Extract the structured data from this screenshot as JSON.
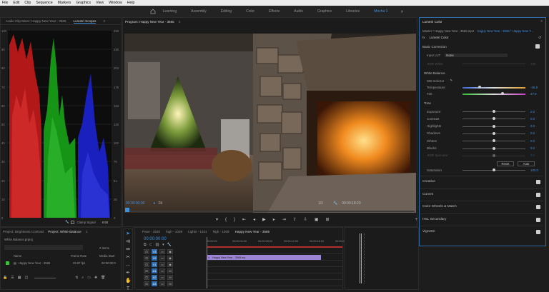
{
  "menubar": [
    "File",
    "Edit",
    "Clip",
    "Sequence",
    "Markers",
    "Graphics",
    "View",
    "Window",
    "Help"
  ],
  "workspaces": {
    "tabs": [
      "Learning",
      "Assembly",
      "Editing",
      "Color",
      "Effects",
      "Audio",
      "Graphics",
      "Libraries",
      "Mocha 1"
    ],
    "active": "Mocha 1",
    "more": "»"
  },
  "scopes_panel": {
    "tab_mixer": "Audio Clip Mixer: Happy New Year - 3565",
    "tab_scopes": "Lumetri Scopes",
    "menu": "≡",
    "left_scale": [
      "100",
      "90",
      "80",
      "70",
      "60",
      "50",
      "40",
      "30",
      "20",
      "10",
      "0"
    ],
    "right_scale": [
      "255",
      "230",
      "204",
      "178",
      "153",
      "128",
      "102",
      "76",
      "51",
      "26",
      "0"
    ],
    "clamp_label": "Clamp Signal",
    "bit_label": "8 Bit"
  },
  "program": {
    "title": "Program: Happy New Year - 3565",
    "menu": "≡",
    "timecode_left": "00:00:00:00",
    "fit_option": "Fit",
    "quality": "1/2",
    "timecode_right": "00:00:18:20"
  },
  "lumetri": {
    "title": "Lumetri Color",
    "menu": "≡",
    "master": "Master * Happy New Year - 3565.mp4",
    "clip": "Happy New Year - 3565 * Happy New Y...",
    "effect": "Lumetri Color",
    "basic_correction": "Basic Correction",
    "input_lut_label": "Input LUT",
    "input_lut_value": "None",
    "hdr_white_label": "HDR White",
    "hdr_white_value": "100",
    "white_balance": "White Balance",
    "wb_selector": "WB Selector",
    "temperature_label": "Temperature",
    "temperature_value": "-46.8",
    "temperature_pct": 0.27,
    "tint_label": "Tint",
    "tint_value": "27.8",
    "tint_pct": 0.64,
    "tone": "Tone",
    "tone_rows": [
      {
        "label": "Exposure",
        "value": "0.0",
        "pct": 0.5
      },
      {
        "label": "Contrast",
        "value": "0.0",
        "pct": 0.5
      },
      {
        "label": "Highlights",
        "value": "0.0",
        "pct": 0.5
      },
      {
        "label": "Shadows",
        "value": "0.0",
        "pct": 0.5
      },
      {
        "label": "Whites",
        "value": "0.0",
        "pct": 0.5
      },
      {
        "label": "Blacks",
        "value": "0.0",
        "pct": 0.5
      },
      {
        "label": "HDR Specular",
        "value": "0.0",
        "pct": 0.5
      }
    ],
    "reset_label": "Reset",
    "auto_label": "Auto",
    "saturation_label": "Saturation",
    "saturation_value": "100.0",
    "saturation_pct": 0.5,
    "sections": [
      "Creative",
      "Curves",
      "Color Wheels & Match",
      "HSL Secondary",
      "Vignette"
    ]
  },
  "project": {
    "tab1": "Project: Brightness Contrast",
    "tab2": "Project: White Balance",
    "menu": "≡",
    "file": "White Balance.prproj",
    "items": "2 Items",
    "col_name": "Name",
    "col_rate": "Frame Rate",
    "col_start": "Media Start",
    "row_name": "Happy New Year - 3565",
    "row_rate": "29.97 fps",
    "row_start": "00:00:00:0"
  },
  "timeline": {
    "tabs": [
      "Pane - 3530",
      "high - 1009",
      "Lights - 1341",
      "high - 1009",
      "Happy New Year - 3565"
    ],
    "active_tab": "Happy New Year - 3565",
    "timecode": "00:00:00:00",
    "ruler": [
      "00:00:00",
      "00:00:04:00",
      "00:00:08:00",
      "00:00:12:00",
      "00:00:16:00",
      "00:00:2"
    ],
    "tracks": [
      {
        "name": "V3",
        "label": "V3"
      },
      {
        "name": "V2",
        "label": "V2"
      },
      {
        "name": "V1",
        "label": "V1"
      },
      {
        "name": "A1",
        "label": "A1"
      },
      {
        "name": "A2",
        "label": "A2"
      },
      {
        "name": "A3",
        "label": "A3"
      }
    ],
    "clip_label": "Happy New Year - 3565.mp",
    "clip_fx": "fx"
  },
  "colors": {
    "accent": "#3d8fe0",
    "clip": "#9b84d3",
    "playhead": "#3d8fe0",
    "scope_red": "#d21f1f",
    "scope_green": "#1fb21f",
    "scope_blue": "#1f2bd6"
  }
}
